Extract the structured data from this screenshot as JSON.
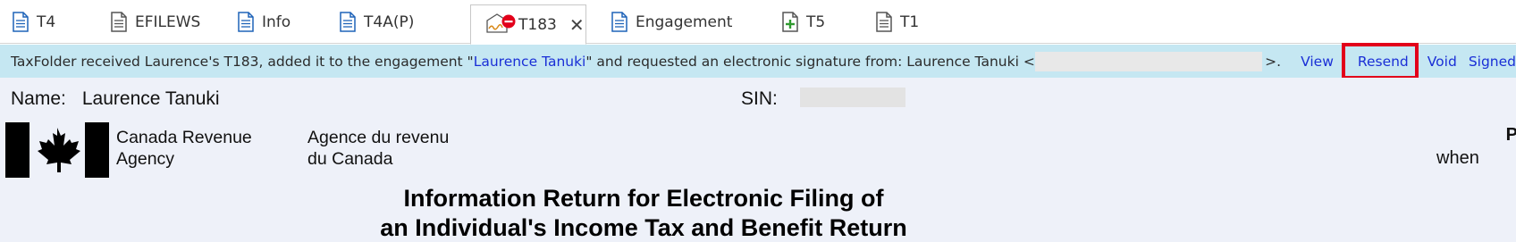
{
  "tabs": [
    {
      "label": "T4",
      "icon": "document-icon",
      "active": false
    },
    {
      "label": "EFILEWS",
      "icon": "document-icon",
      "active": false
    },
    {
      "label": "Info",
      "icon": "document-icon",
      "active": false
    },
    {
      "label": "T4A(P)",
      "icon": "document-icon",
      "active": false
    },
    {
      "label": "T183",
      "icon": "signature-pending-icon",
      "active": true
    },
    {
      "label": "Engagement",
      "icon": "document-icon",
      "active": false
    },
    {
      "label": "T5",
      "icon": "document-add-icon",
      "active": false
    },
    {
      "label": "T1",
      "icon": "document-icon",
      "active": false
    }
  ],
  "notification": {
    "prefix": "TaxFolder received Laurence's T183, added it to the engagement \"",
    "engagement_link": "Laurence Tanuki",
    "middle": "\" and requested an electronic signature from: Laurence Tanuki <",
    "suffix": ">.",
    "actions": {
      "view": "View",
      "resend": "Resend",
      "void": "Void",
      "signed": "Signed"
    },
    "highlight_color": "#e2001a"
  },
  "form": {
    "name_label": "Name:",
    "name_value": "Laurence Tanuki",
    "sin_label": "SIN:",
    "agency_en_1": "Canada Revenue",
    "agency_en_2": "Agency",
    "agency_fr_1": "Agence du revenu",
    "agency_fr_2": "du Canada",
    "right_cut_1": "P",
    "right_cut_2": "when",
    "title_line1": "Information Return for Electronic Filing of",
    "title_line2": "an Individual's Income Tax and Benefit Return"
  }
}
